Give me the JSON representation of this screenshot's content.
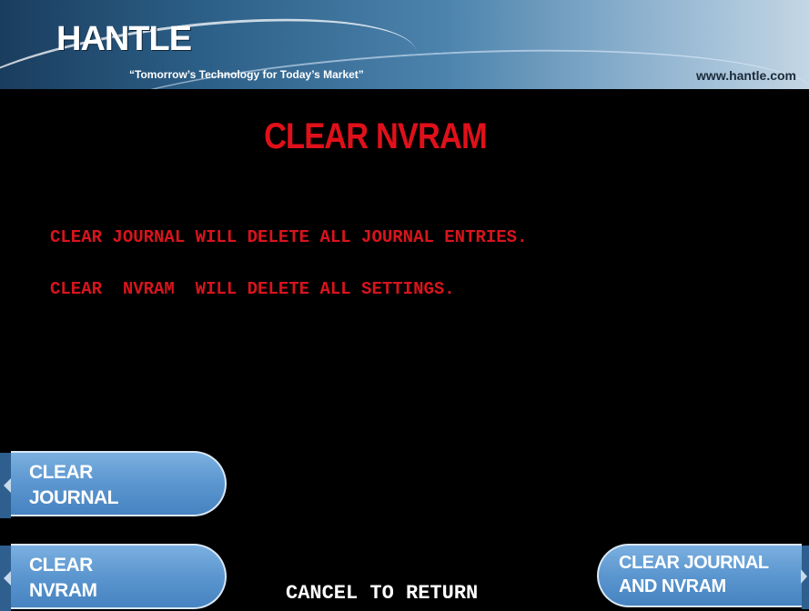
{
  "header": {
    "logo_text": "HANTLE",
    "tagline": "“Tomorrow’s Technology for Today’s Market”",
    "website": "www.hantle.com"
  },
  "screen": {
    "title": "CLEAR NVRAM",
    "messages": [
      "CLEAR JOURNAL WILL DELETE ALL JOURNAL ENTRIES.",
      "CLEAR  NVRAM  WILL DELETE ALL SETTINGS."
    ],
    "footer": "CANCEL TO RETURN"
  },
  "buttons": {
    "left": [
      {
        "label": "CLEAR\nJOURNAL"
      },
      {
        "label": "CLEAR\nNVRAM"
      }
    ],
    "right": [
      {
        "label": "CLEAR JOURNAL\nAND NVRAM"
      }
    ]
  },
  "colors": {
    "background": "#000000",
    "title_red": "#e0101a",
    "message_red": "#d8141c",
    "button_blue": "#5b96cf"
  }
}
